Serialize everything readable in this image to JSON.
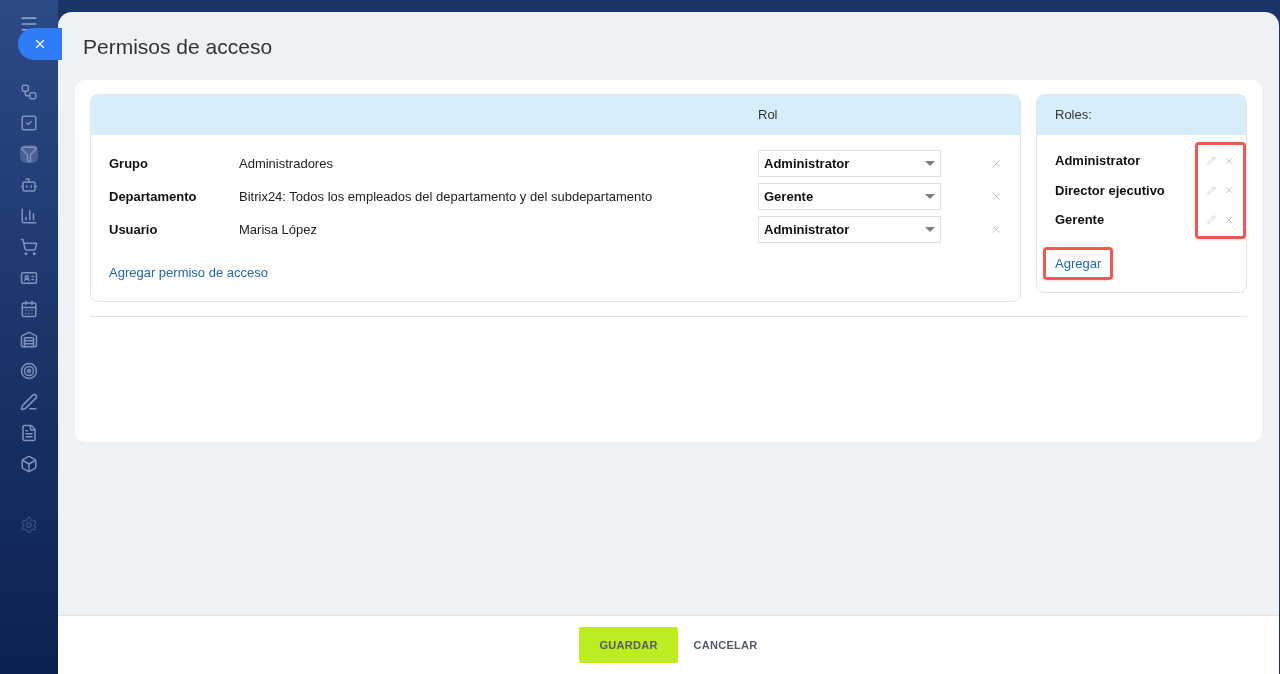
{
  "title": "Permisos de acceso",
  "permissions": {
    "columns": [
      "Rol"
    ],
    "rows": [
      {
        "type": "Grupo",
        "name": "Administradores",
        "role": "Administrator"
      },
      {
        "type": "Departamento",
        "name": "Bitrix24: Todos los empleados del departamento y del subdepartamento",
        "role": "Gerente"
      },
      {
        "type": "Usuario",
        "name": "Marisa López",
        "role": "Administrator"
      }
    ],
    "add_link": "Agregar permiso de acceso"
  },
  "roles": {
    "title": "Roles:",
    "items": [
      "Administrator",
      "Director ejecutivo",
      "Gerente"
    ],
    "add_link": "Agregar"
  },
  "buttons": [
    {
      "label": "GUARDAR",
      "kind": "primary"
    },
    {
      "label": "CANCELAR",
      "kind": "link"
    }
  ]
}
